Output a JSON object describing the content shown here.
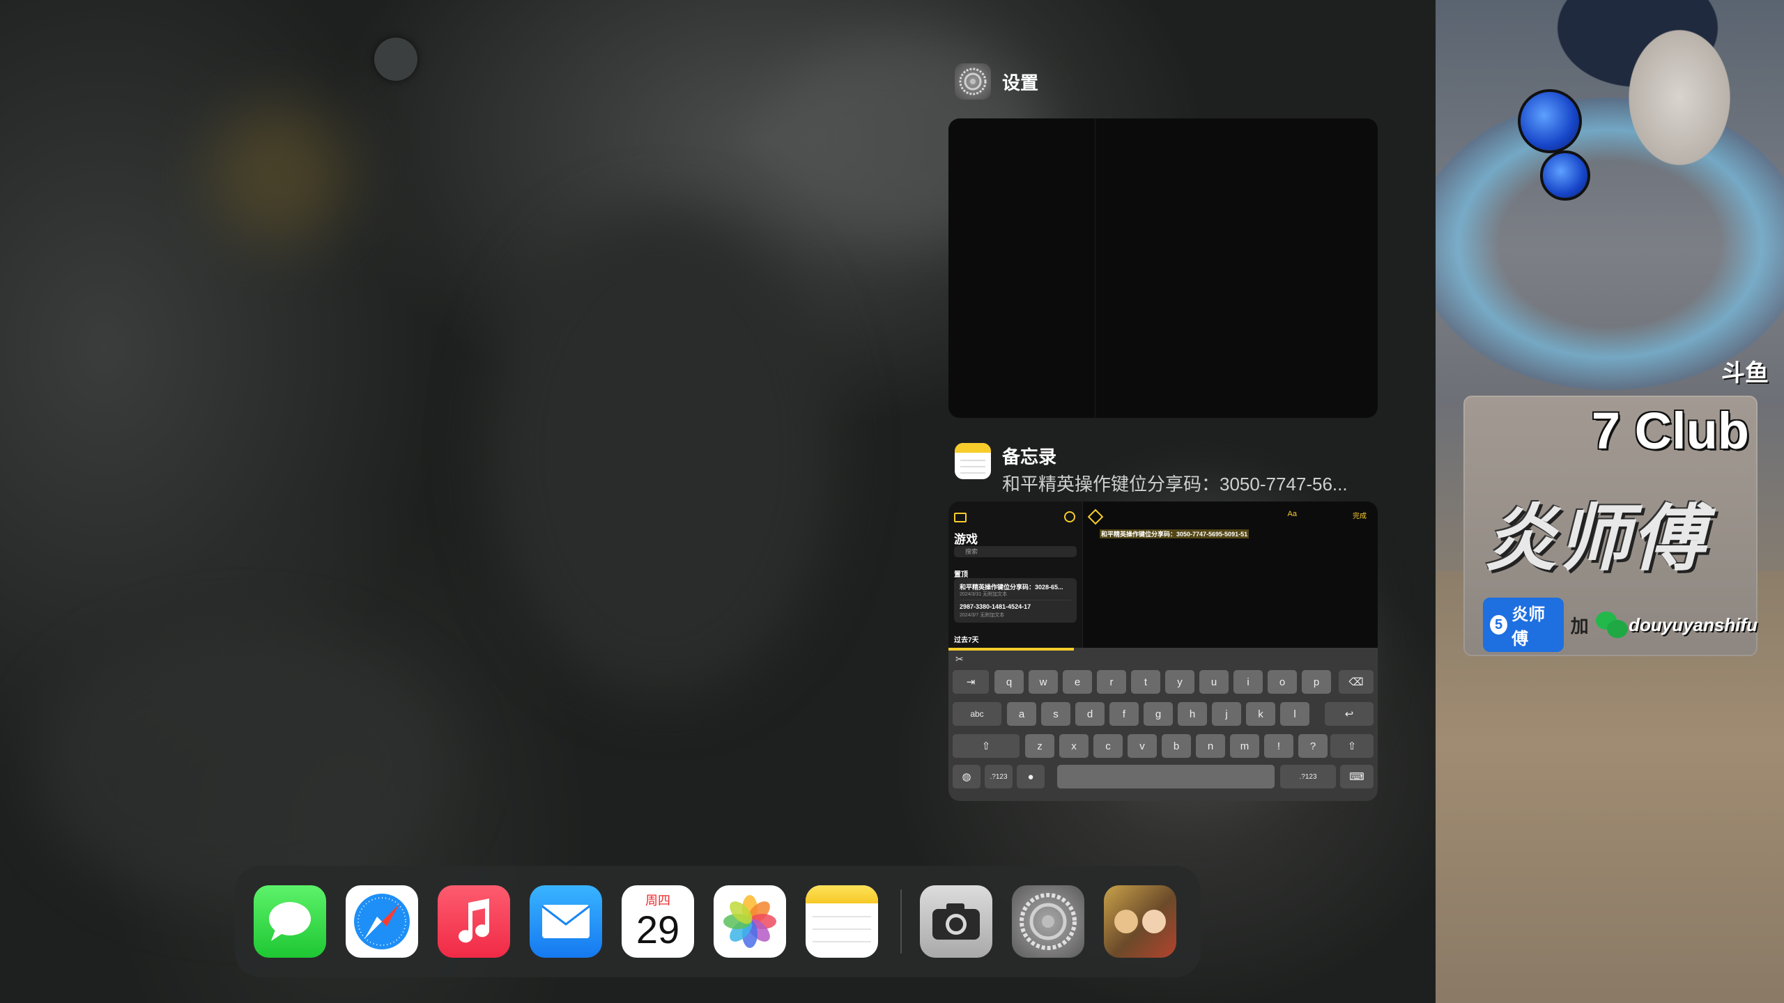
{
  "app_switcher": {
    "settings_card": {
      "app_name": "设置",
      "icon": "gear-icon"
    },
    "notes_card": {
      "app_name": "备忘录",
      "subtitle": "和平精英操作键位分享码：3050-7747-56...",
      "icon": "notes-icon",
      "preview": {
        "folder_title": "游戏",
        "search_placeholder": "搜索",
        "section_pinned": "置顶",
        "section_recent": "过去7天",
        "notes": [
          {
            "title": "和平精英操作键位分享码：3028-65...",
            "meta": "2024/3/31 无附加文本"
          },
          {
            "title": "2987-3380-1481-4524-17",
            "meta": "2024/3/7 无附加文本"
          }
        ],
        "editor_text": "和平精英操作键位分享码：3050-7747-5695-5091-51",
        "done_label": "完成",
        "format_label": "Aa",
        "keyboard": {
          "row1": [
            "q",
            "w",
            "e",
            "r",
            "t",
            "y",
            "u",
            "i",
            "o",
            "p"
          ],
          "row2": [
            "a",
            "s",
            "d",
            "f",
            "g",
            "h",
            "j",
            "k",
            "l"
          ],
          "row3": [
            "z",
            "x",
            "c",
            "v",
            "b",
            "n",
            "m",
            "!",
            "?"
          ],
          "abc_label": "abc",
          "num_label": ".?123"
        }
      }
    }
  },
  "dock": {
    "apps": [
      {
        "name": "Messages",
        "icon": "messages-icon"
      },
      {
        "name": "Safari",
        "icon": "safari-icon"
      },
      {
        "name": "Music",
        "icon": "music-icon"
      },
      {
        "name": "Mail",
        "icon": "mail-icon"
      },
      {
        "name": "Calendar",
        "icon": "calendar-icon",
        "weekday": "周四",
        "day": "29"
      },
      {
        "name": "Photos",
        "icon": "photos-icon"
      },
      {
        "name": "Notes",
        "icon": "notes-icon"
      },
      {
        "name": "Camera",
        "icon": "camera-icon"
      },
      {
        "name": "Settings",
        "icon": "gear-icon"
      },
      {
        "name": "和平精英",
        "icon": "game-icon"
      }
    ]
  },
  "stream_overlay": {
    "platform": "斗鱼",
    "club_title": "7 Club",
    "streamer_name": "炎师傅",
    "badge_text": "炎师傅",
    "badge_num": "5",
    "plus_text": "加",
    "wechat_handle": "douyuyanshifu"
  }
}
